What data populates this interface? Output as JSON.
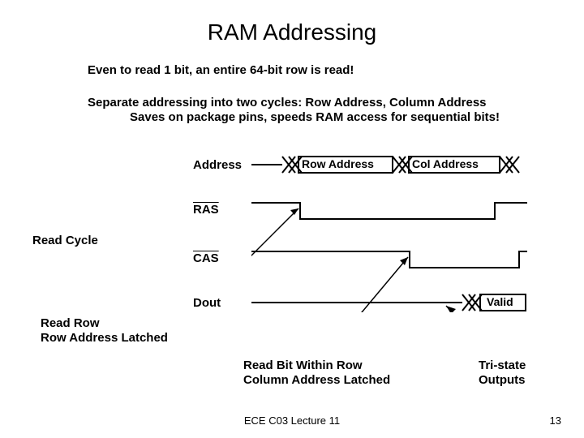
{
  "title": "RAM Addressing",
  "subtitle": "Even to read 1 bit, an entire 64-bit row is read!",
  "desc1": "Separate addressing into two cycles: Row Address, Column Address",
  "desc2": "Saves on package pins, speeds RAM access for sequential bits!",
  "signals": {
    "address": "Address",
    "ras": "RAS",
    "cas": "CAS",
    "dout": "Dout"
  },
  "bus": {
    "row": "Row Address",
    "col": "Col Address",
    "valid": "Valid"
  },
  "read_cycle": "Read Cycle",
  "annotations": {
    "read_row": "Read Row",
    "row_latched": "Row Address Latched",
    "read_bit": "Read Bit Within Row",
    "col_latched": "Column Address Latched",
    "tristate": "Tri-state",
    "outputs": "Outputs"
  },
  "footer": "ECE C03 Lecture 11",
  "page": "13"
}
